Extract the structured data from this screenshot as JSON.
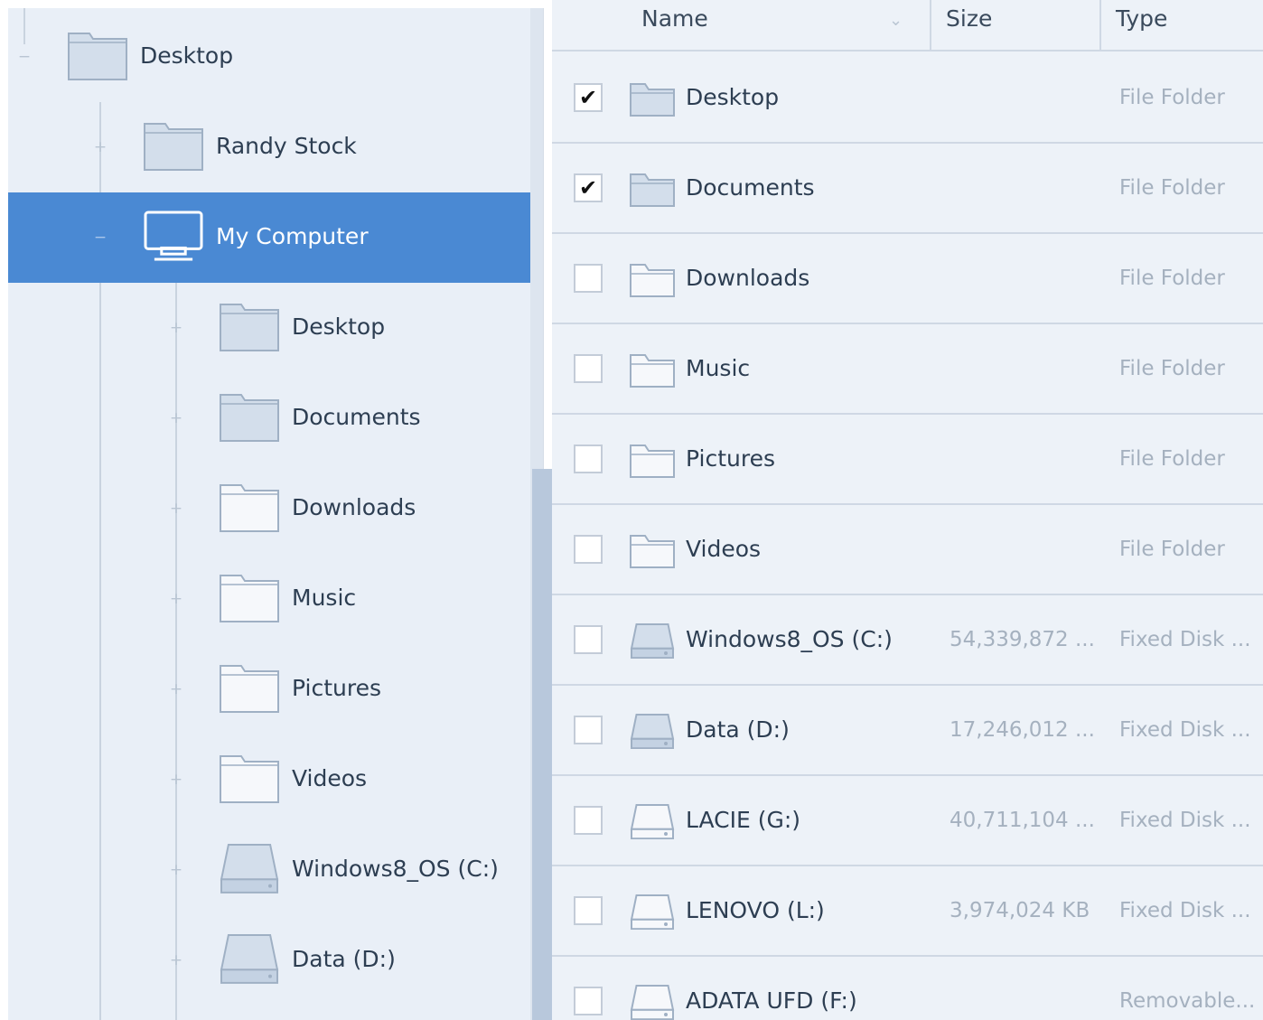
{
  "tree": {
    "items": [
      {
        "label": "Desktop",
        "icon": "folder-filled-icon",
        "toggle": "−",
        "selected": false,
        "level": 0
      },
      {
        "label": "Randy Stock",
        "icon": "folder-filled-icon",
        "toggle": "+",
        "selected": false,
        "level": 1
      },
      {
        "label": "My Computer",
        "icon": "monitor-icon",
        "toggle": "−",
        "selected": true,
        "level": 1
      },
      {
        "label": "Desktop",
        "icon": "folder-filled-icon",
        "toggle": "+",
        "selected": false,
        "level": 2
      },
      {
        "label": "Documents",
        "icon": "folder-filled-icon",
        "toggle": "+",
        "selected": false,
        "level": 2
      },
      {
        "label": "Downloads",
        "icon": "folder-outline-icon",
        "toggle": "+",
        "selected": false,
        "level": 2
      },
      {
        "label": "Music",
        "icon": "folder-outline-icon",
        "toggle": "+",
        "selected": false,
        "level": 2
      },
      {
        "label": "Pictures",
        "icon": "folder-outline-icon",
        "toggle": "+",
        "selected": false,
        "level": 2
      },
      {
        "label": "Videos",
        "icon": "folder-outline-icon",
        "toggle": "+",
        "selected": false,
        "level": 2
      },
      {
        "label": "Windows8_OS (C:)",
        "icon": "drive-filled-icon",
        "toggle": "+",
        "selected": false,
        "level": 2
      },
      {
        "label": "Data (D:)",
        "icon": "drive-filled-icon",
        "toggle": "+",
        "selected": false,
        "level": 2
      }
    ]
  },
  "list": {
    "columns": {
      "name": "Name",
      "size": "Size",
      "type": "Type"
    },
    "rows": [
      {
        "checked": true,
        "icon": "folder-filled-icon",
        "name": "Desktop",
        "size": "",
        "type": "File Folder"
      },
      {
        "checked": true,
        "icon": "folder-filled-icon",
        "name": "Documents",
        "size": "",
        "type": "File Folder"
      },
      {
        "checked": false,
        "icon": "folder-outline-icon",
        "name": "Downloads",
        "size": "",
        "type": "File Folder"
      },
      {
        "checked": false,
        "icon": "folder-outline-icon",
        "name": "Music",
        "size": "",
        "type": "File Folder"
      },
      {
        "checked": false,
        "icon": "folder-outline-icon",
        "name": "Pictures",
        "size": "",
        "type": "File Folder"
      },
      {
        "checked": false,
        "icon": "folder-outline-icon",
        "name": "Videos",
        "size": "",
        "type": "File Folder"
      },
      {
        "checked": false,
        "icon": "drive-filled-icon",
        "name": "Windows8_OS (C:)",
        "size": "54,339,872 ...",
        "type": "Fixed Disk ..."
      },
      {
        "checked": false,
        "icon": "drive-filled-icon",
        "name": "Data (D:)",
        "size": "17,246,012 ...",
        "type": "Fixed Disk ..."
      },
      {
        "checked": false,
        "icon": "drive-outline-icon",
        "name": "LACIE (G:)",
        "size": "40,711,104 ...",
        "type": "Fixed Disk ..."
      },
      {
        "checked": false,
        "icon": "drive-outline-icon",
        "name": "LENOVO (L:)",
        "size": "3,974,024 KB",
        "type": "Fixed Disk ..."
      },
      {
        "checked": false,
        "icon": "drive-outline-icon",
        "name": "ADATA UFD (F:)",
        "size": "",
        "type": "Removable..."
      }
    ]
  },
  "colors": {
    "tree_bg": "#e9eff7",
    "selection": "#4a89d3",
    "list_bg": "#edf2f8",
    "icon_fill": "#d3deeb",
    "icon_stroke": "#9fb0c4"
  }
}
